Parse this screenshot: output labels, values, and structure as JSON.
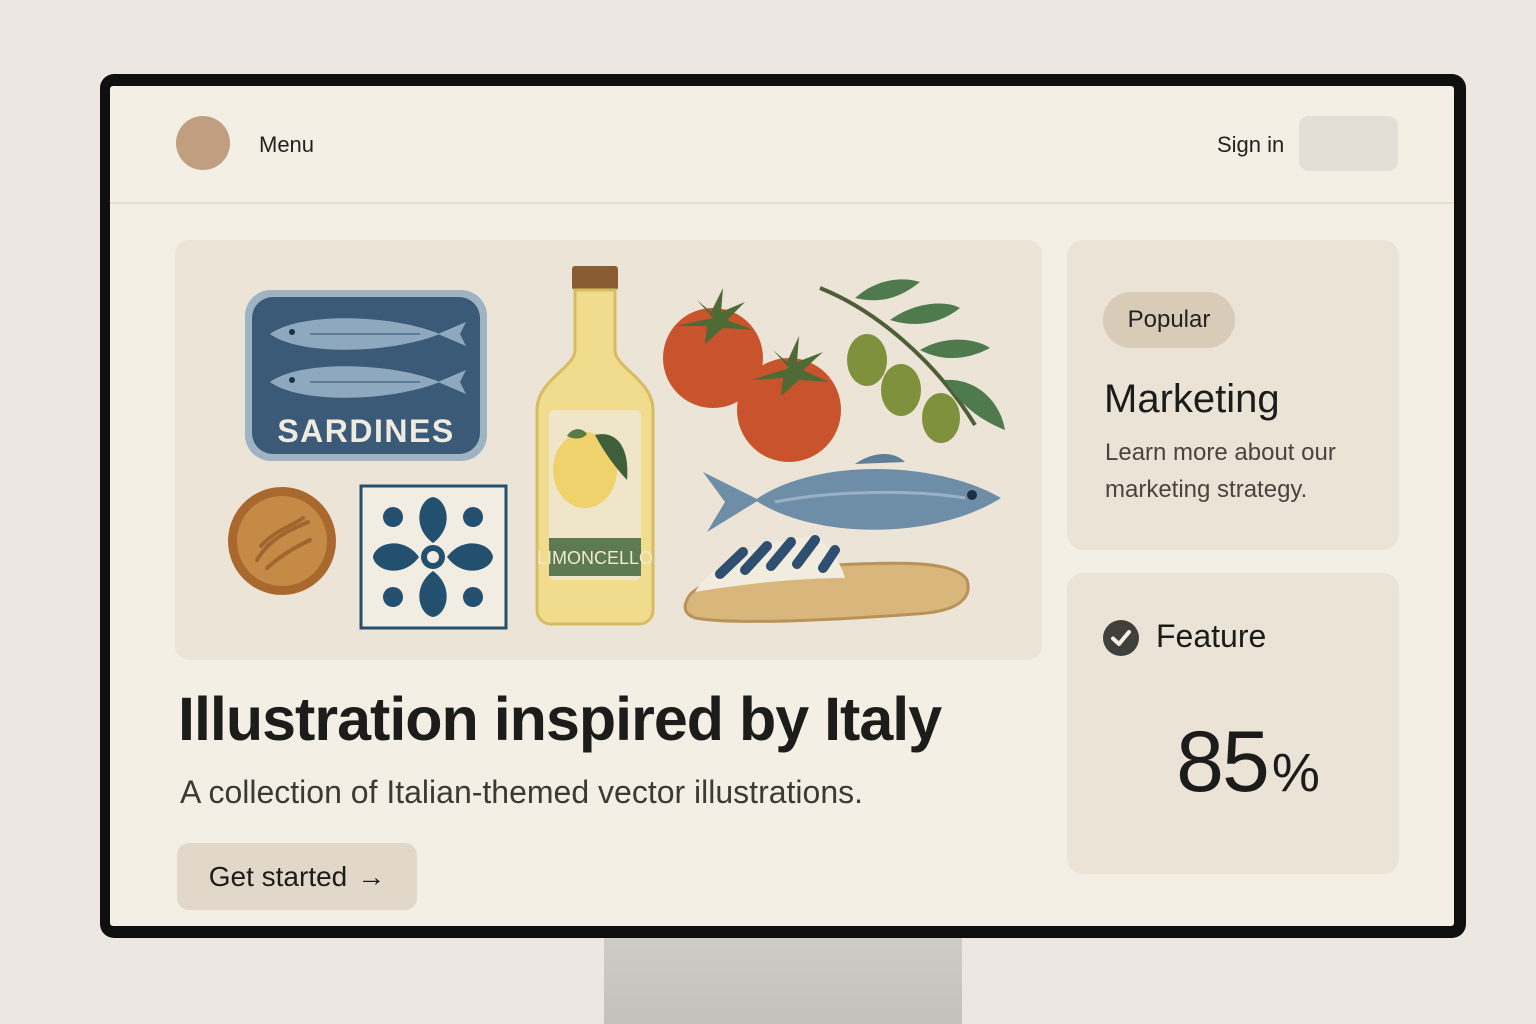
{
  "header": {
    "menu_label": "Menu",
    "signin_label": "Sign in"
  },
  "hero": {
    "title": "Illustration inspired by Italy",
    "subtitle": "A collection of Italian-themed vector illustrations.",
    "cta_label": "Get started",
    "cta_icon": "arrow-right-icon",
    "illustration": {
      "sardines_label": "SARDINES",
      "bottle_label": "LIMONCELLO"
    }
  },
  "cards": {
    "marketing": {
      "badge": "Popular",
      "title": "Marketing",
      "description": "Learn more about our marketing strategy."
    },
    "feature": {
      "icon": "check-circle-icon",
      "label": "Feature",
      "value": "85",
      "unit": "%"
    }
  },
  "colors": {
    "page_bg": "#f4efe5",
    "card_bg": "#ebe3d6",
    "accent_navy": "#3a5a78",
    "accent_tomato": "#c9532c",
    "accent_olive": "#7f913c"
  }
}
